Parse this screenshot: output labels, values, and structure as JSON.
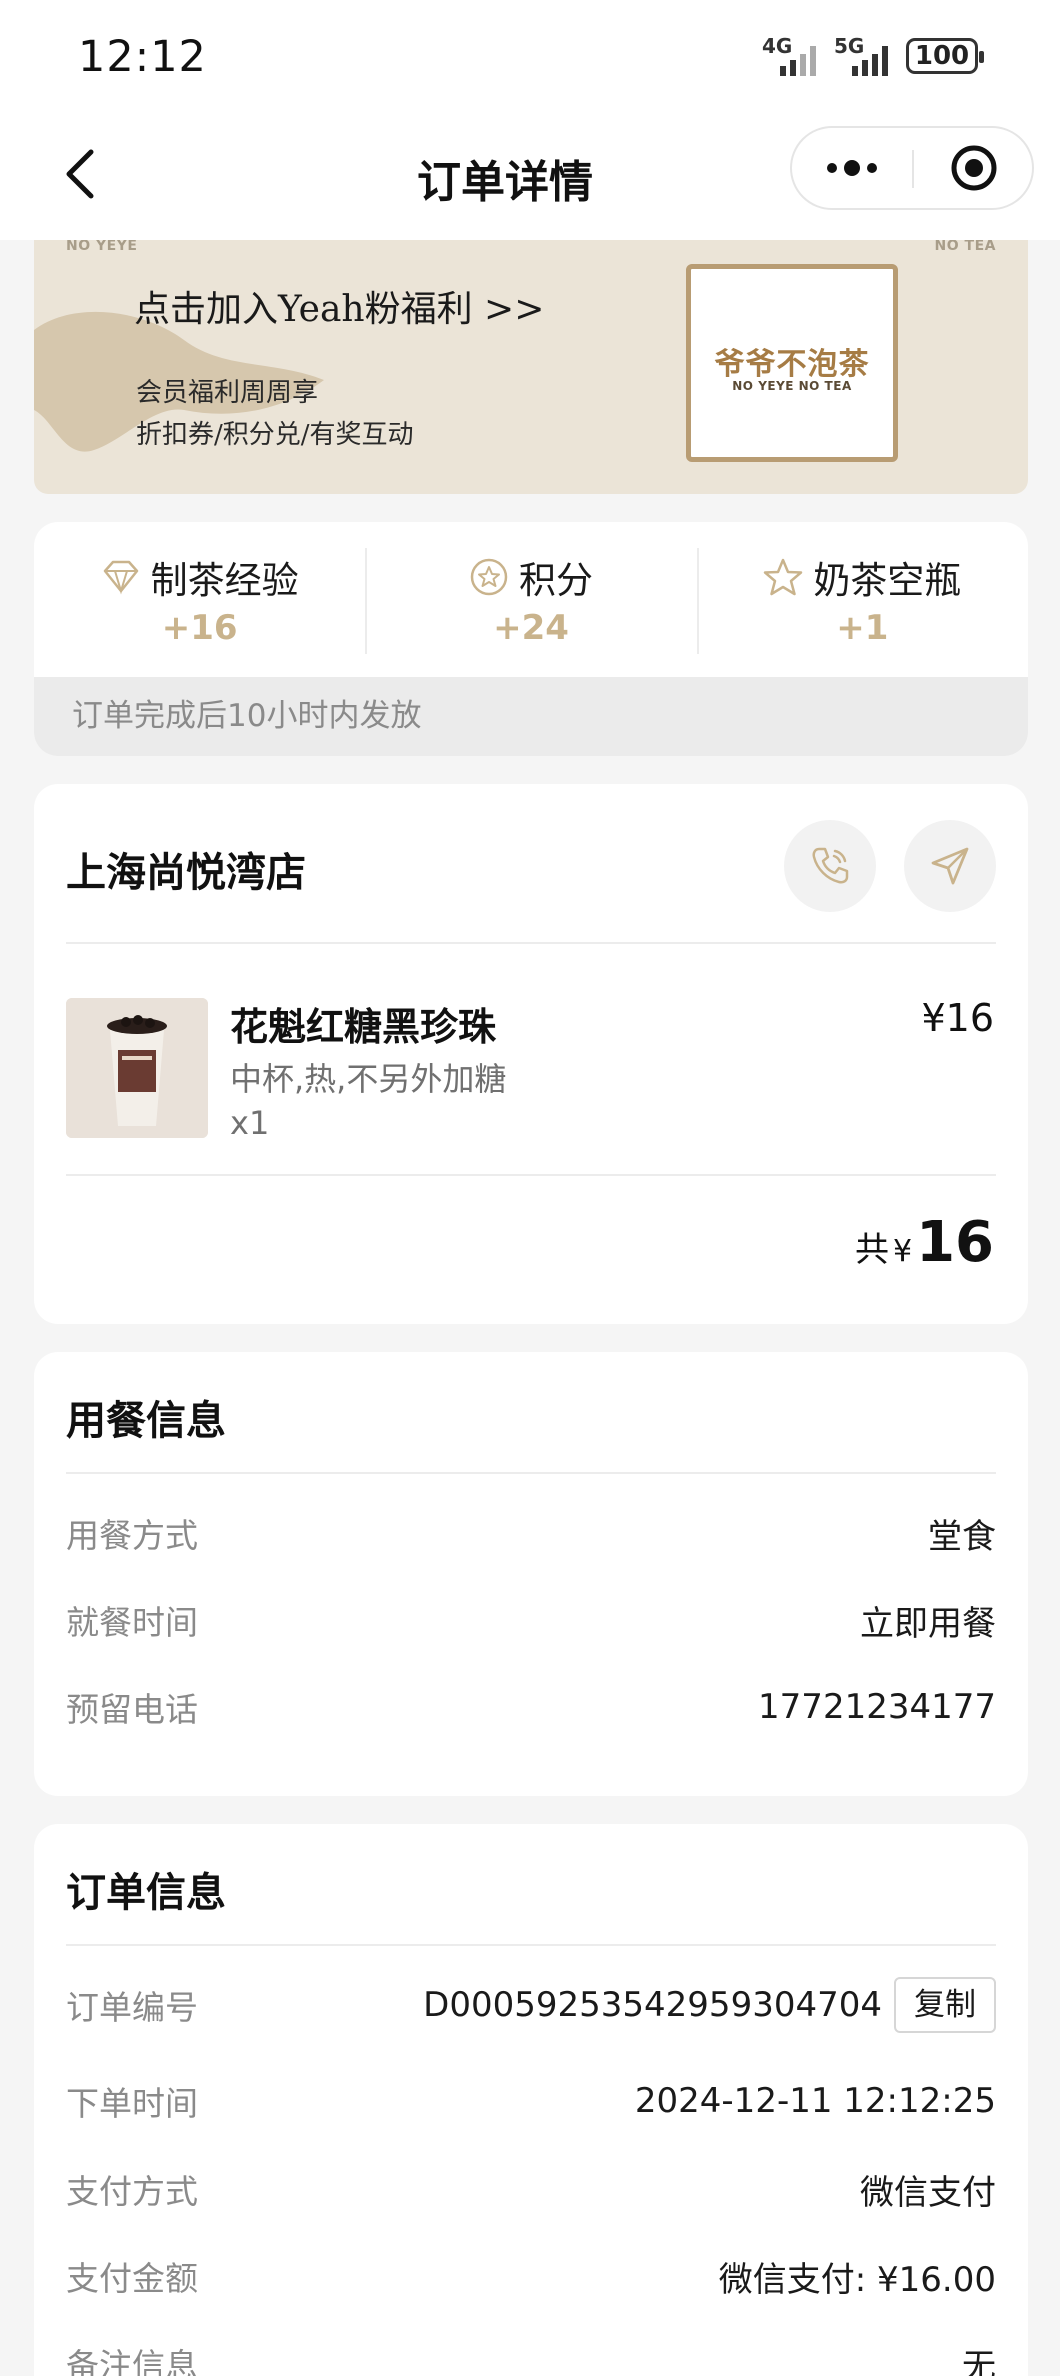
{
  "status_bar": {
    "time": "12:12",
    "signal1": "4G",
    "signal2": "5G",
    "battery": "100"
  },
  "nav": {
    "title": "订单详情"
  },
  "banner": {
    "corner_left": "NO YEYE",
    "corner_right": "NO TEA",
    "title": "点击加入Yeah粉福利 >>",
    "sub1": "会员福利周周享",
    "sub2": "折扣券/积分兑/有奖互动",
    "logo_cn": "爷爷不泡茶",
    "logo_en": "NO YEYE NO TEA"
  },
  "rewards": {
    "items": [
      {
        "label": "制茶经验",
        "value": "+16",
        "icon": "diamond-icon"
      },
      {
        "label": "积分",
        "value": "+24",
        "icon": "points-icon"
      },
      {
        "label": "奶茶空瓶",
        "value": "+1",
        "icon": "star-icon"
      }
    ],
    "note": "订单完成后10小时内发放"
  },
  "store": {
    "name": "上海尚悦湾店",
    "product": {
      "name": "花魁红糖黑珍珠",
      "options": "中杯,热,不另外加糖",
      "qty": "x1",
      "price": "¥16"
    },
    "total_label": "共",
    "total_currency": "¥",
    "total_amount": "16"
  },
  "dining": {
    "title": "用餐信息",
    "rows": [
      {
        "k": "用餐方式",
        "v": "堂食"
      },
      {
        "k": "就餐时间",
        "v": "立即用餐"
      },
      {
        "k": "预留电话",
        "v": "17721234177"
      }
    ]
  },
  "order": {
    "title": "订单信息",
    "rows": [
      {
        "k": "订单编号",
        "v": "D0005925354295930470​4"
      },
      {
        "k": "下单时间",
        "v": "2024-12-11 12:12:25"
      },
      {
        "k": "支付方式",
        "v": "微信支付"
      },
      {
        "k": "支付金额",
        "v": "微信支付: ¥16.00"
      },
      {
        "k": "备注信息",
        "v": "无"
      }
    ],
    "copy_label": "复制"
  },
  "colors": {
    "accent_gold": "#c9b38c",
    "banner_bg": "#ebe4d7",
    "logo_gold": "#a67c45"
  }
}
